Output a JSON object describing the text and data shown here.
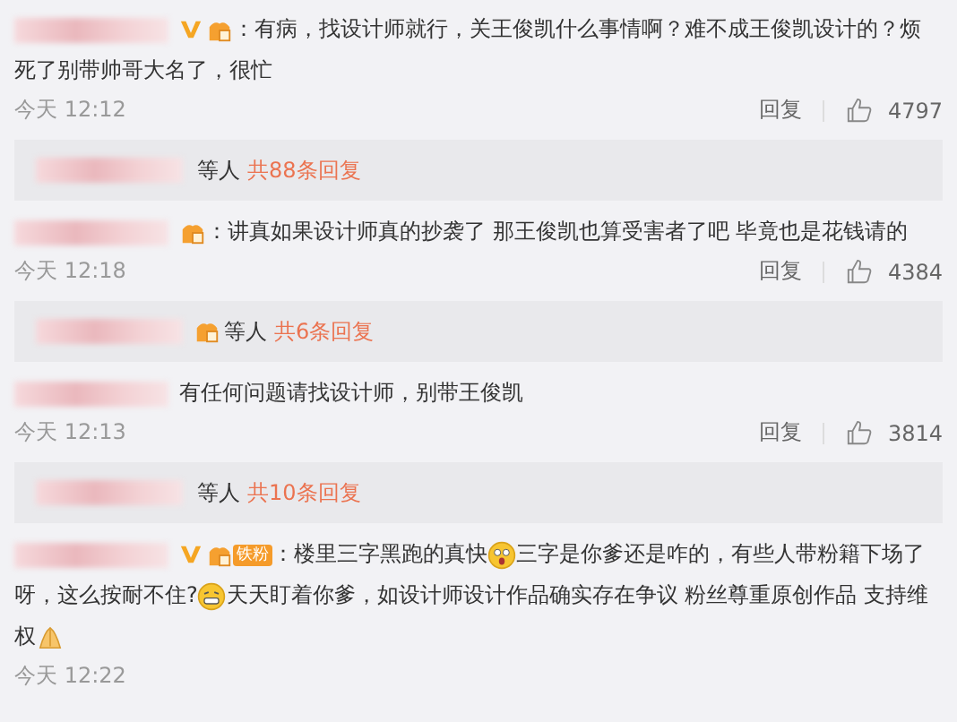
{
  "comments": [
    {
      "verified": true,
      "fan_badge": true,
      "segments": [
        {
          "kind": "text",
          "text": "：有病，找设计师就行，关王俊凯什么事情啊？难不成王俊凯设计的？烦"
        },
        {
          "kind": "text",
          "text": "死了别带帅哥大名了，很忙"
        }
      ],
      "time": "今天 12:12",
      "reply": "回复",
      "likes": "4797",
      "thread": {
        "fan_badge": false,
        "suffix": "等人",
        "count": "共88条回复"
      }
    },
    {
      "verified": false,
      "fan_badge": true,
      "segments": [
        {
          "kind": "text",
          "text": "：讲真如果设计师真的抄袭了 那王俊凯也算受害者了吧 毕竟也是花钱请的"
        }
      ],
      "time": "今天 12:18",
      "reply": "回复",
      "likes": "4384",
      "thread": {
        "fan_badge": true,
        "suffix": "等人",
        "count": "共6条回复"
      }
    },
    {
      "verified": false,
      "fan_badge": false,
      "segments": [
        {
          "kind": "text",
          "text": "有任何问题请找设计师，别带王俊凯"
        }
      ],
      "time": "今天 12:13",
      "reply": "回复",
      "likes": "3814",
      "thread": {
        "fan_badge": false,
        "suffix": "等人",
        "count": "共10条回复"
      }
    },
    {
      "verified": true,
      "fan_badge": true,
      "badge_label": "铁粉",
      "segments": [
        {
          "kind": "text",
          "text": "：楼里三字黑跑的真快"
        },
        {
          "kind": "surprised-emoji"
        },
        {
          "kind": "text",
          "text": "三字是你爹还是咋的，有些人带粉籍下场了"
        },
        {
          "kind": "text",
          "text": "呀，这么按耐不住?"
        },
        {
          "kind": "grin-emoji"
        },
        {
          "kind": "text",
          "text": "天天盯着你爹，如设计师设计作品确实存在争议 粉丝尊重原创作品 支持维"
        },
        {
          "kind": "text",
          "text": "权"
        },
        {
          "kind": "pray-emoji"
        }
      ],
      "time": "今天 12:22"
    }
  ]
}
